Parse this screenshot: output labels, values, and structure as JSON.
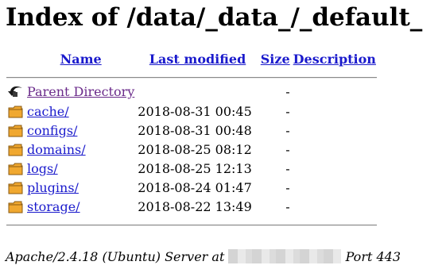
{
  "page_title": "Index of /data/_data_/_default_",
  "columns": {
    "name": "Name",
    "last_modified": "Last modified",
    "size": "Size",
    "description": "Description"
  },
  "parent": {
    "label": "Parent Directory",
    "size": "-",
    "icon": "back-arrow-icon"
  },
  "entries": [
    {
      "name": "cache/",
      "modified": "2018-08-31 00:45",
      "size": "-",
      "icon": "folder-icon"
    },
    {
      "name": "configs/",
      "modified": "2018-08-31 00:48",
      "size": "-",
      "icon": "folder-icon"
    },
    {
      "name": "domains/",
      "modified": "2018-08-25 08:12",
      "size": "-",
      "icon": "folder-icon"
    },
    {
      "name": "logs/",
      "modified": "2018-08-25 12:13",
      "size": "-",
      "icon": "folder-icon"
    },
    {
      "name": "plugins/",
      "modified": "2018-08-24 01:47",
      "size": "-",
      "icon": "folder-icon"
    },
    {
      "name": "storage/",
      "modified": "2018-08-22 13:49",
      "size": "-",
      "icon": "folder-icon"
    }
  ],
  "footer": {
    "server": "Apache/2.4.18 (Ubuntu) Server at",
    "port": "Port 443"
  },
  "colors": {
    "link": "#1a1acc",
    "visited_link": "#6a2a8a",
    "folder": "#f0a830"
  }
}
